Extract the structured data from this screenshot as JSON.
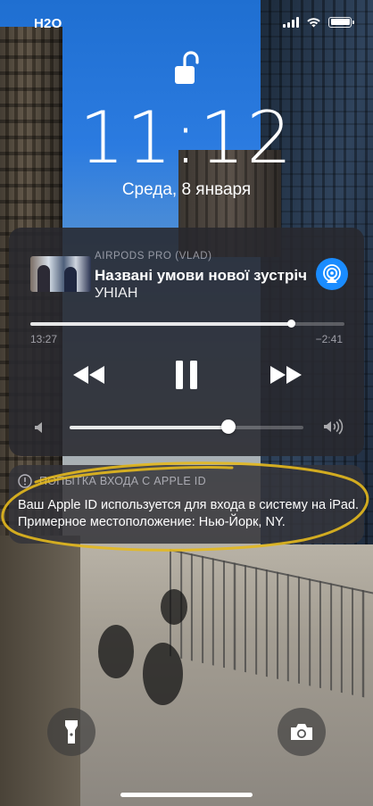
{
  "status_bar": {
    "carrier": "H2O",
    "icons": [
      "signal-icon",
      "wifi-icon",
      "battery-icon"
    ]
  },
  "lock_screen": {
    "lock_icon": "unlocked-padlock-icon",
    "time": "11:12",
    "date": "Среда, 8 января"
  },
  "now_playing": {
    "source": "AIRPODS PRO (VLAD)",
    "title": "Названі умови нової зустріч",
    "artist": "УНІАН",
    "elapsed": "13:27",
    "remaining": "−2:41",
    "progress": 0.83,
    "volume": 0.68,
    "controls": [
      "rewind-icon",
      "pause-icon",
      "fast-forward-icon"
    ],
    "airplay_icon": "airplay-audio-icon",
    "accent_color": "#1a8cff"
  },
  "notification": {
    "header": "ПОПЫТКА ВХОДА С APPLE ID",
    "body": "Ваш Apple ID используется для входа в систему на iPad. Примерное местоположение: Нью-Йорк, NY.",
    "icon": "info-circle-icon"
  },
  "quick_actions": {
    "left": "flashlight-icon",
    "right": "camera-icon"
  }
}
